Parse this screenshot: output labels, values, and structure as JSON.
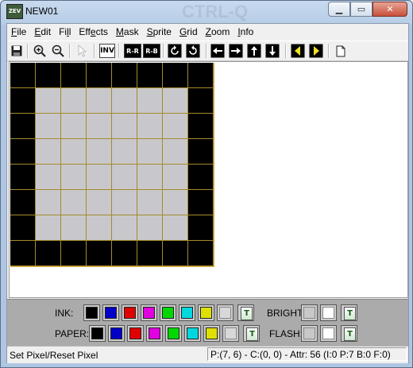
{
  "window": {
    "title": "NEW01",
    "app_icon_text": "ZEV",
    "background_watermark": "CTRL-Q",
    "minimize_icon": "minimize-icon",
    "maximize_icon": "maximize-icon",
    "close_icon": "close-icon"
  },
  "menu": [
    {
      "u": "F",
      "rest": "ile"
    },
    {
      "u": "E",
      "rest": "dit"
    },
    {
      "pre": "Fi",
      "u": "l",
      "rest": "l"
    },
    {
      "pre": "Eff",
      "u": "e",
      "rest": "cts"
    },
    {
      "u": "M",
      "rest": "ask"
    },
    {
      "u": "S",
      "rest": "prite"
    },
    {
      "u": "G",
      "rest": "rid"
    },
    {
      "u": "Z",
      "rest": "oom"
    },
    {
      "u": "I",
      "rest": "nfo"
    }
  ],
  "toolbar": {
    "save_icon": "floppy-disk-icon",
    "zoom_in_icon": "zoom-in-icon",
    "zoom_out_icon": "zoom-out-icon",
    "pointer_icon": "pointer-icon",
    "invert_label": "INV",
    "reflect_h_label": "R-R",
    "reflect_v_label": "R-B",
    "rotate_ccw_icon": "rotate-ccw-icon",
    "rotate_cw_icon": "rotate-cw-icon",
    "shift_left_icon": "shift-left-icon",
    "shift_right_icon": "shift-right-icon",
    "shift_up_icon": "shift-up-icon",
    "shift_down_icon": "shift-down-icon",
    "prev_frame_icon": "previous-frame-icon",
    "next_frame_icon": "next-frame-icon",
    "new_icon": "new-page-icon"
  },
  "sprite": {
    "rows": [
      [
        1,
        1,
        1,
        1,
        1,
        1,
        1,
        1
      ],
      [
        1,
        0,
        0,
        0,
        0,
        0,
        0,
        1
      ],
      [
        1,
        0,
        0,
        0,
        0,
        0,
        0,
        1
      ],
      [
        1,
        0,
        0,
        0,
        0,
        0,
        0,
        1
      ],
      [
        1,
        0,
        0,
        0,
        0,
        0,
        0,
        1
      ],
      [
        1,
        0,
        0,
        0,
        0,
        0,
        0,
        1
      ],
      [
        1,
        0,
        0,
        0,
        0,
        0,
        0,
        1
      ],
      [
        1,
        1,
        1,
        1,
        1,
        1,
        1,
        1
      ]
    ],
    "ink_color": "#000000",
    "paper_color": "#c8c8cc"
  },
  "palette": {
    "ink_label": "INK:",
    "paper_label": "PAPER:",
    "bright_label": "BRIGHT:",
    "flash_label": "FLASH:",
    "colors": [
      "#000000",
      "#0000c8",
      "#e00000",
      "#e000e0",
      "#00d800",
      "#00d8e0",
      "#e0e000",
      "#d8d8d8"
    ],
    "transparent_glyph": "T"
  },
  "status": {
    "left": "Set Pixel/Reset Pixel",
    "right": "P:(7, 6) - C:(0, 0) - Attr: 56 (I:0 P:7 B:0 F:0)"
  }
}
